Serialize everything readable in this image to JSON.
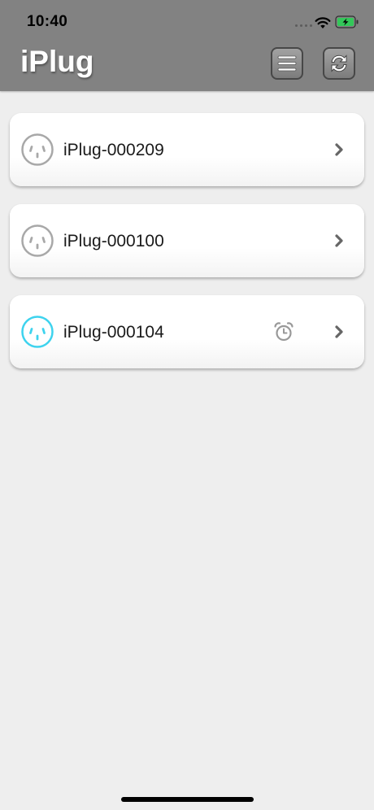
{
  "status_bar": {
    "time": "10:40"
  },
  "header": {
    "title": "iPlug",
    "menu_icon": "menu-icon",
    "refresh_icon": "refresh-icon"
  },
  "devices": [
    {
      "name": "iPlug-000209",
      "active": false,
      "has_timer": false
    },
    {
      "name": "iPlug-000100",
      "active": false,
      "has_timer": false
    },
    {
      "name": "iPlug-000104",
      "active": true,
      "has_timer": true
    }
  ],
  "colors": {
    "header_bg": "#828282",
    "page_bg": "#eeeeee",
    "plug_inactive": "#a8a8a8",
    "plug_active": "#3ed3ee",
    "battery_fill": "#33c759"
  }
}
